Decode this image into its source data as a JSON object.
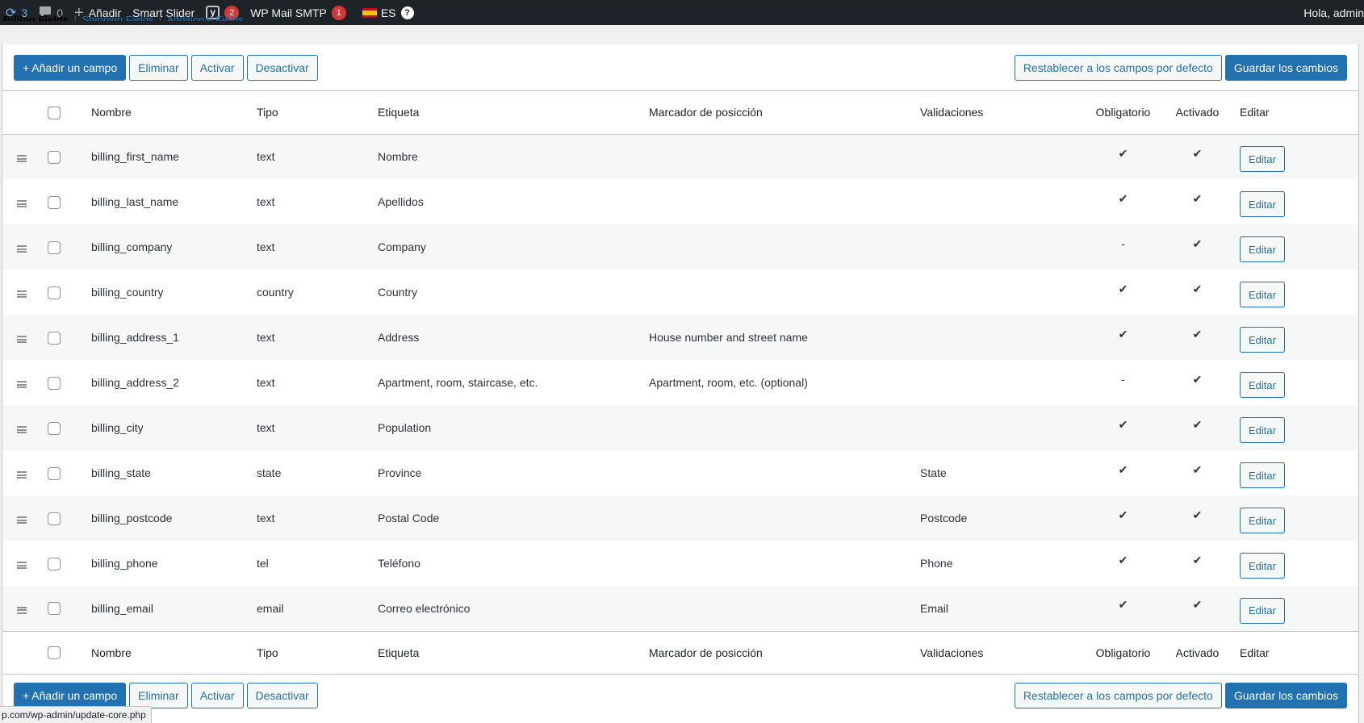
{
  "adminbar": {
    "updates_count": "3",
    "comments_count": "0",
    "add_label": "Añadir",
    "smart_slider": "Smart Slider",
    "yoast_badge": "2",
    "wp_mail_smtp": "WP Mail SMTP",
    "wp_mail_smtp_badge": "1",
    "language": "ES",
    "help": "?",
    "greeting": "Hola, admin"
  },
  "subsub": {
    "billing": "Billing Fields",
    "shipping": "Shipping Fields",
    "additional": "Additional Fields",
    "sep": "|"
  },
  "toolbar": {
    "add_field": "+ Añadir un campo",
    "delete": "Eliminar",
    "activate": "Activar",
    "deactivate": "Desactivar",
    "reset": "Restablecer a los campos por defecto",
    "save": "Guardar los cambios"
  },
  "columns": {
    "name": "Nombre",
    "type": "Tipo",
    "label": "Etiqueta",
    "placeholder": "Marcador de posicción",
    "validations": "Validaciones",
    "required": "Obligatorio",
    "enabled": "Activado",
    "edit": "Editar"
  },
  "rows": [
    {
      "name": "billing_first_name",
      "type": "text",
      "label": "Nombre",
      "placeholder": "",
      "validation": "",
      "required": "✔",
      "enabled": "✔",
      "edit": "Editar"
    },
    {
      "name": "billing_last_name",
      "type": "text",
      "label": "Apellidos",
      "placeholder": "",
      "validation": "",
      "required": "✔",
      "enabled": "✔",
      "edit": "Editar"
    },
    {
      "name": "billing_company",
      "type": "text",
      "label": "Company",
      "placeholder": "",
      "validation": "",
      "required": "-",
      "enabled": "✔",
      "edit": "Editar"
    },
    {
      "name": "billing_country",
      "type": "country",
      "label": "Country",
      "placeholder": "",
      "validation": "",
      "required": "✔",
      "enabled": "✔",
      "edit": "Editar"
    },
    {
      "name": "billing_address_1",
      "type": "text",
      "label": "Address",
      "placeholder": "House number and street name",
      "validation": "",
      "required": "✔",
      "enabled": "✔",
      "edit": "Editar"
    },
    {
      "name": "billing_address_2",
      "type": "text",
      "label": "Apartment, room, staircase, etc.",
      "placeholder": "Apartment, room, etc. (optional)",
      "validation": "",
      "required": "-",
      "enabled": "✔",
      "edit": "Editar"
    },
    {
      "name": "billing_city",
      "type": "text",
      "label": "Population",
      "placeholder": "",
      "validation": "",
      "required": "✔",
      "enabled": "✔",
      "edit": "Editar"
    },
    {
      "name": "billing_state",
      "type": "state",
      "label": "Province",
      "placeholder": "",
      "validation": "State",
      "required": "✔",
      "enabled": "✔",
      "edit": "Editar"
    },
    {
      "name": "billing_postcode",
      "type": "text",
      "label": "Postal Code",
      "placeholder": "",
      "validation": "Postcode",
      "required": "✔",
      "enabled": "✔",
      "edit": "Editar"
    },
    {
      "name": "billing_phone",
      "type": "tel",
      "label": "Teléfono",
      "placeholder": "",
      "validation": "Phone",
      "required": "✔",
      "enabled": "✔",
      "edit": "Editar"
    },
    {
      "name": "billing_email",
      "type": "email",
      "label": "Correo electrónico",
      "placeholder": "",
      "validation": "Email",
      "required": "✔",
      "enabled": "✔",
      "edit": "Editar"
    }
  ],
  "status_url": "p.com/wp-admin/update-core.php"
}
